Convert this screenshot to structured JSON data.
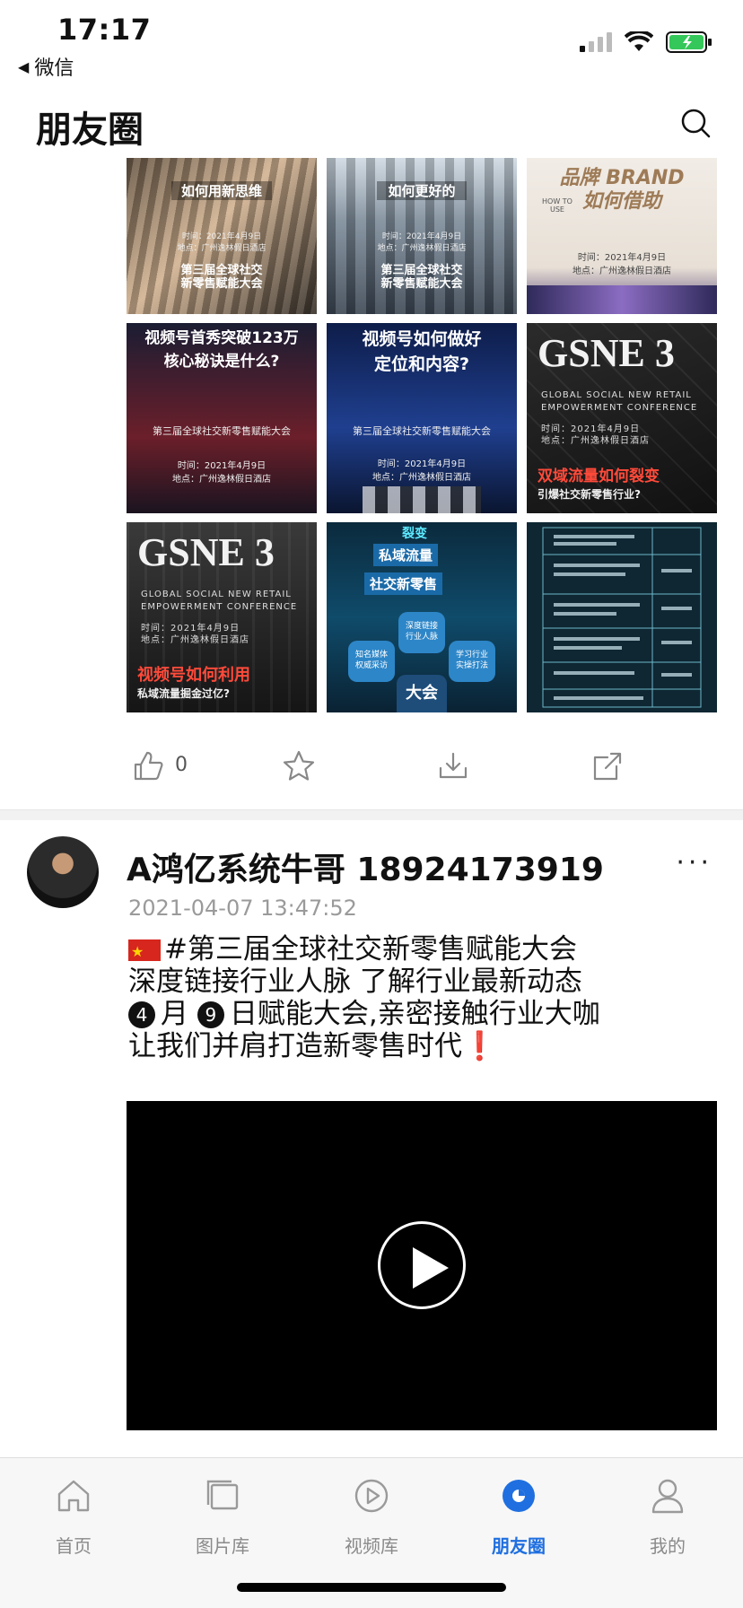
{
  "status": {
    "time": "17:17",
    "back_label": "微信"
  },
  "nav": {
    "title": "朋友圈"
  },
  "grid": {
    "tiles": [
      {
        "headline": "如何用新思维",
        "event_title": "第三届全球社交\n新零售赋能大会",
        "date_line": "时间：2021年4月9日\n地点：广州逸林假日酒店"
      },
      {
        "headline": "如何更好的",
        "event_title": "第三届全球社交\n新零售赋能大会",
        "date_line": "时间：2021年4月9日\n地点：广州逸林假日酒店"
      },
      {
        "headline": "品牌 BRAND\n如何借助",
        "subtitle": "HOW TO USE",
        "date_line": "时间：2021年4月9日\n地点：广州逸林假日酒店"
      },
      {
        "headline": "视频号首秀突破123万\n核心秘诀是什么?",
        "event_title": "第三届全球社交新零售赋能大会",
        "date_line": "时间：2021年4月9日\n地点：广州逸林假日酒店"
      },
      {
        "headline": "视频号如何做好\n定位和内容?",
        "event_title": "第三届全球社交新零售赋能大会",
        "date_line": "时间：2021年4月9日\n地点：广州逸林假日酒店"
      },
      {
        "brand": "GSNE 3",
        "conf": "GLOBAL SOCIAL NEW RETAIL\nEMPOWERMENT CONFERENCE",
        "date_line": "时间：2021年4月9日\n地点：广州逸林假日酒店",
        "headline": "双域流量如何裂变",
        "sub": "引爆社交新零售行业?"
      },
      {
        "brand": "GSNE 3",
        "conf": "GLOBAL SOCIAL NEW RETAIL\nEMPOWERMENT CONFERENCE",
        "date_line": "时间：2021年4月9日\n地点：广州逸林假日酒店",
        "headline": "视频号如何利用",
        "sub": "私域流量掘金过亿?"
      },
      {
        "tags": [
          "裂变",
          "私域流量",
          "社交新零售"
        ],
        "hex": [
          "深度链接\n行业人脉",
          "知名媒体\n权威采访",
          "学习行业\n实操打法"
        ],
        "center": "大会"
      },
      {
        "kind": "schedule"
      }
    ]
  },
  "actions": {
    "like_count": "0"
  },
  "post": {
    "author": "A鸿亿系统牛哥 18924173919",
    "timestamp": "2021-04-07 13:47:52",
    "line1": "#第三届全球社交新零售赋能大会",
    "line2": "深度链接行业人脉 了解行业最新动态",
    "num1": "4",
    "line3a": "月",
    "num2": "9",
    "line3b": "日赋能大会,亲密接触行业大咖",
    "line4": "让我们并肩打造新零售时代",
    "bang": "❗"
  },
  "tabs": [
    {
      "label": "首页",
      "icon": "home-icon"
    },
    {
      "label": "图片库",
      "icon": "gallery-icon"
    },
    {
      "label": "视频库",
      "icon": "video-library-icon"
    },
    {
      "label": "朋友圈",
      "icon": "moments-icon",
      "active": true
    },
    {
      "label": "我的",
      "icon": "profile-icon"
    }
  ],
  "colors": {
    "accent": "#1f6fe0",
    "alert_red": "#e0291c"
  }
}
